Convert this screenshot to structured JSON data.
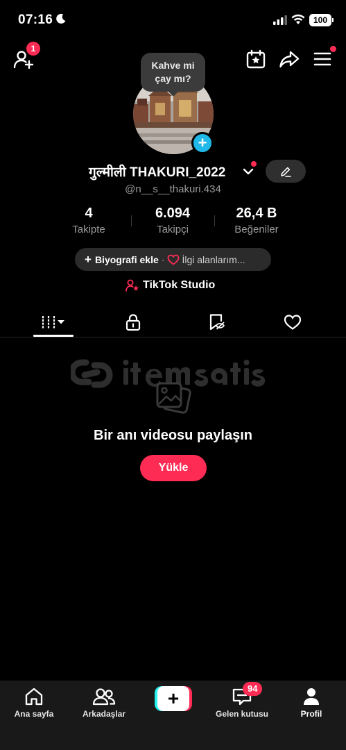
{
  "status_bar": {
    "time": "07:16",
    "battery": "100"
  },
  "top_nav": {
    "add_friend_badge": "1"
  },
  "profile": {
    "bubble_text_line1": "Kahve mi",
    "bubble_text_line2": "çay mı?",
    "display_name": "गुल्मीली THAKURI_2022",
    "username": "@n__s__thakuri.434",
    "stats": {
      "following_value": "4",
      "following_label": "Takipte",
      "followers_value": "6.094",
      "followers_label": "Takipçi",
      "likes_value": "26,4 B",
      "likes_label": "Beğeniler"
    },
    "bio_add_label": "Biyografi ekle",
    "bio_separator": "·",
    "interests_label": "İlgi alanlarım...",
    "studio_label": "TikTok Studio"
  },
  "empty_state": {
    "title": "Bir anı videosu paylaşın",
    "upload_label": "Yükle"
  },
  "bottom_nav": {
    "home": "Ana sayfa",
    "friends": "Arkadaşlar",
    "inbox": "Gelen kutusu",
    "inbox_badge": "94",
    "profile": "Profil"
  },
  "colors": {
    "accent": "#fe2c55",
    "cyan": "#25f4ee",
    "avatar_plus": "#20b8e8",
    "background": "#000000"
  }
}
